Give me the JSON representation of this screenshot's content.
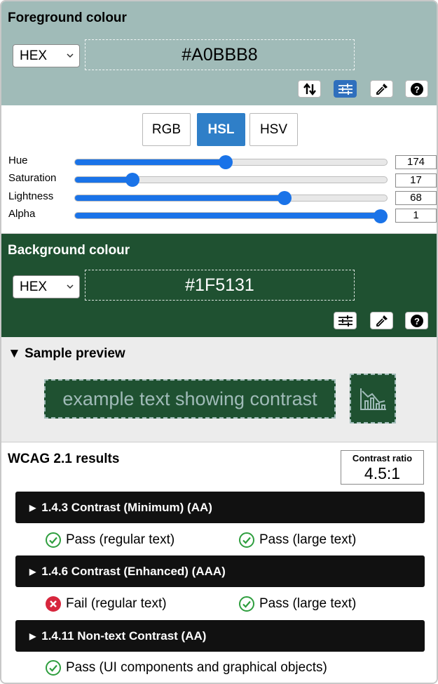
{
  "foreground": {
    "title": "Foreground colour",
    "format": "HEX",
    "value": "#A0BBB8",
    "color": "#a0bbb8",
    "tools": [
      "swap-icon",
      "sliders-icon",
      "eyedropper-icon",
      "help-icon"
    ]
  },
  "picker": {
    "modes": [
      "RGB",
      "HSL",
      "HSV"
    ],
    "active_mode": "HSL",
    "sliders": [
      {
        "label": "Hue",
        "value": "174",
        "level": 0.483
      },
      {
        "label": "Saturation",
        "value": "17",
        "level": 0.17
      },
      {
        "label": "Lightness",
        "value": "68",
        "level": 0.68
      },
      {
        "label": "Alpha",
        "value": "1",
        "level": 1.0
      }
    ],
    "accent": "#1a73e8"
  },
  "background": {
    "title": "Background colour",
    "format": "HEX",
    "value": "#1F5131",
    "color": "#1f5131",
    "tools": [
      "sliders-icon",
      "eyedropper-icon",
      "help-icon"
    ]
  },
  "preview": {
    "title": "▼ Sample preview",
    "sample_text": "example text showing contrast",
    "icon": "chart-icon"
  },
  "results": {
    "title": "WCAG 2.1 results",
    "ratio_label": "Contrast ratio",
    "ratio_value": "4.5:1",
    "criteria": [
      {
        "label": "1.4.3 Contrast (Minimum) (AA)",
        "outcomes": [
          {
            "status": "pass",
            "text": "Pass (regular text)"
          },
          {
            "status": "pass",
            "text": "Pass (large text)"
          }
        ]
      },
      {
        "label": "1.4.6 Contrast (Enhanced) (AAA)",
        "outcomes": [
          {
            "status": "fail",
            "text": "Fail (regular text)"
          },
          {
            "status": "pass",
            "text": "Pass (large text)"
          }
        ]
      },
      {
        "label": "1.4.11 Non-text Contrast (AA)",
        "outcomes": [
          {
            "status": "pass",
            "text": "Pass (UI components and graphical objects)"
          }
        ]
      }
    ],
    "pass_color": "#2e9e3e",
    "fail_color": "#d7263d"
  }
}
